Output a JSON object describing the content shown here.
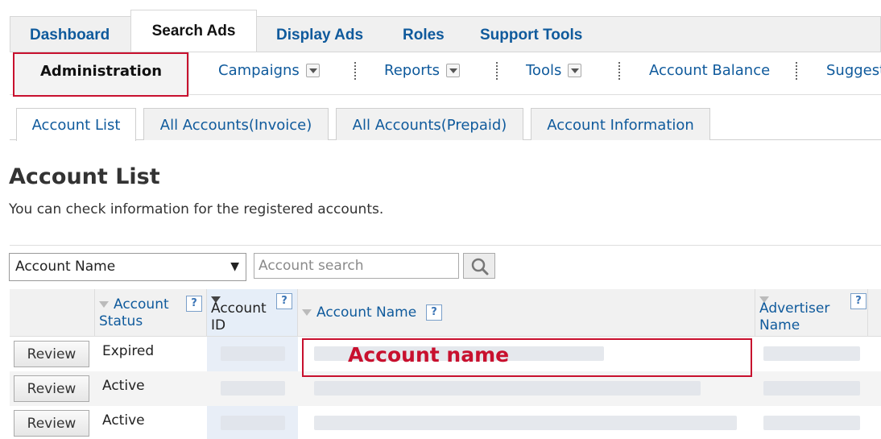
{
  "top_tabs": [
    "Dashboard",
    "Search Ads",
    "Display Ads",
    "Roles",
    "Support Tools"
  ],
  "sub_nav": {
    "active": "Administration",
    "items": [
      "Campaigns",
      "Reports",
      "Tools",
      "Account Balance",
      "Suggest"
    ]
  },
  "page_tabs": [
    "Account List",
    "All Accounts(Invoice)",
    "All Accounts(Prepaid)",
    "Account Information"
  ],
  "page": {
    "title": "Account List",
    "description": "You can check information for the registered accounts."
  },
  "filter": {
    "selected": "Account Name",
    "search_placeholder": "Account search"
  },
  "table": {
    "headers": [
      "Account Status",
      "Account ID",
      "Account Name",
      "Advertiser Name"
    ],
    "help_label": "?",
    "review_label": "Review",
    "rows": [
      {
        "status": "Expired"
      },
      {
        "status": "Active"
      },
      {
        "status": "Active"
      }
    ]
  },
  "annotation": {
    "label": "Account name"
  },
  "colors": {
    "link": "#0f5a9c",
    "highlight": "#c8102e"
  }
}
